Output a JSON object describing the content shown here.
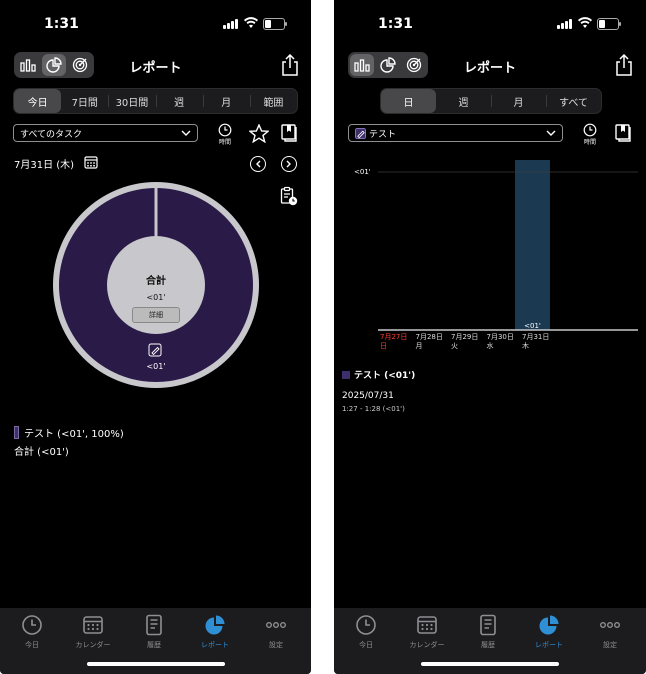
{
  "left": {
    "status_time": "1:31",
    "title": "レポート",
    "periods": [
      {
        "label": "今日",
        "active": true
      },
      {
        "label": "7日間",
        "active": false
      },
      {
        "label": "30日間",
        "active": false
      },
      {
        "label": "週",
        "active": false
      },
      {
        "label": "月",
        "active": false
      },
      {
        "label": "範囲",
        "active": false
      }
    ],
    "task_select": "すべてのタスク",
    "time_label": "時間",
    "date": "7月31日 (木)",
    "donut": {
      "total_label": "合計",
      "total_value": "<01'",
      "detail_button": "詳細",
      "slice_value": "<01'",
      "slice_color": "#2a1a47",
      "ring_color": "#c7c7cc"
    },
    "legend": {
      "item": "テスト (<01', 100%)",
      "total": "合計 (<01')"
    }
  },
  "right": {
    "status_time": "1:31",
    "title": "レポート",
    "periods": [
      {
        "label": "日",
        "active": true
      },
      {
        "label": "週",
        "active": false
      },
      {
        "label": "月",
        "active": false
      },
      {
        "label": "すべて",
        "active": false
      }
    ],
    "task_select": "テスト",
    "time_label": "時間",
    "chart_data": {
      "type": "bar",
      "categories": [
        "7月27日 日",
        "7月28日 月",
        "7月29日 火",
        "7月30日 水",
        "7月31日 木"
      ],
      "day_labels": [
        {
          "date": "7月27日",
          "weekday": "日",
          "sunday": true
        },
        {
          "date": "7月28日",
          "weekday": "月",
          "sunday": false
        },
        {
          "date": "7月29日",
          "weekday": "火",
          "sunday": false
        },
        {
          "date": "7月30日",
          "weekday": "水",
          "sunday": false
        },
        {
          "date": "7月31日",
          "weekday": "木",
          "sunday": false
        }
      ],
      "y_tick": "<01'",
      "bar_value_label": "<01'",
      "selected_index": 4,
      "bar_color": "#1b3a52"
    },
    "legend": "テスト (<01')",
    "record": {
      "date": "2025/07/31",
      "time": "1:27 - 1:28 (<01')"
    }
  },
  "tabbar": [
    {
      "label": "今日",
      "icon": "clock-icon",
      "active": false
    },
    {
      "label": "カレンダー",
      "icon": "calendar-icon",
      "active": false
    },
    {
      "label": "履歴",
      "icon": "history-icon",
      "active": false
    },
    {
      "label": "レポート",
      "icon": "pie-chart-icon",
      "active": true
    },
    {
      "label": "設定",
      "icon": "more-icon",
      "active": false
    }
  ],
  "colors": {
    "accent": "#2f8fd5",
    "sunday": "#ff3b30",
    "task": "#3d2f6b"
  }
}
